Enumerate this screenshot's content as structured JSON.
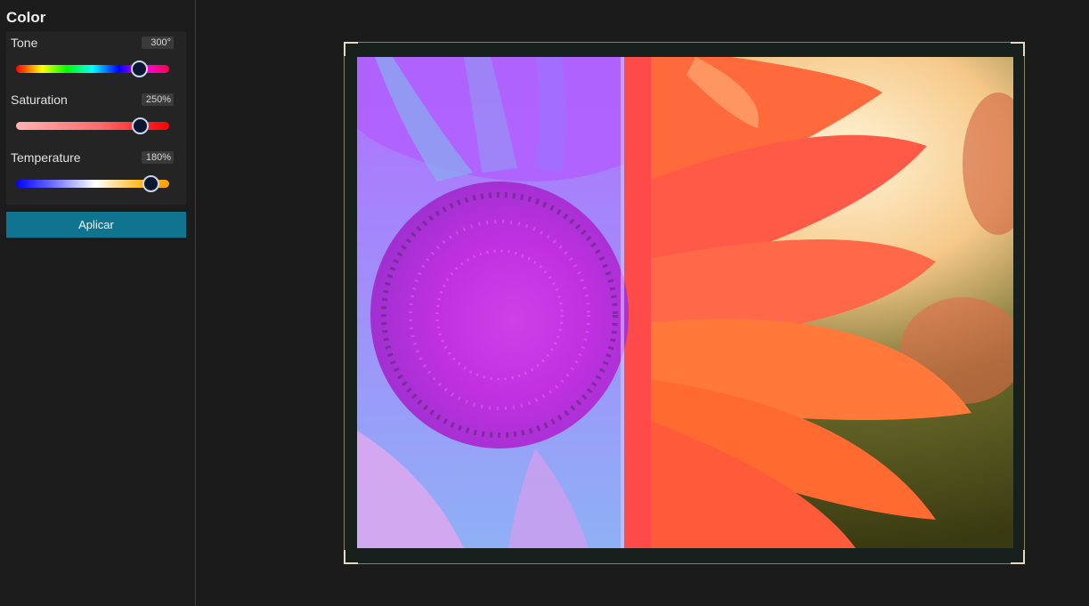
{
  "panel": {
    "title": "Color",
    "controls": [
      {
        "label": "Tone",
        "value_text": "300°",
        "level": 0.8
      },
      {
        "label": "Saturation",
        "value_text": "250%",
        "level": 0.81
      },
      {
        "label": "Temperature",
        "value_text": "180%",
        "level": 0.88
      }
    ],
    "apply_label": "Aplicar"
  },
  "colors": {
    "accent": "#0e7490",
    "background": "#1c1c1c",
    "panel_background": "#242424",
    "crop_corner": "#e8dcc0"
  },
  "icons": {
    "slider_thumb": "circle-handle",
    "crop_corners": "crop-corner-handle"
  }
}
